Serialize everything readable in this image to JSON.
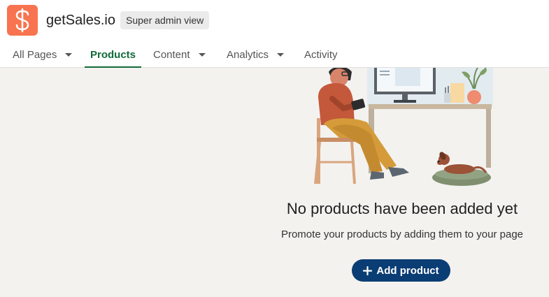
{
  "app": {
    "logo_icon": "dollar-sign-icon",
    "logo_color": "#f8734f",
    "name": "getSales.io",
    "badge": "Super admin view"
  },
  "tabs": [
    {
      "label": "All Pages",
      "dropdown": true,
      "active": false
    },
    {
      "label": "Products",
      "dropdown": false,
      "active": true
    },
    {
      "label": "Content",
      "dropdown": true,
      "active": false
    },
    {
      "label": "Analytics",
      "dropdown": true,
      "active": false
    },
    {
      "label": "Activity",
      "dropdown": false,
      "active": false
    }
  ],
  "empty_state": {
    "illustration": "person-at-desk-with-dog-illustration",
    "title": "No products have been added yet",
    "subtitle": "Promote your products by adding them to your page",
    "button_label": "Add product",
    "button_icon": "plus-icon"
  },
  "colors": {
    "accent_green": "#116b3a",
    "button_navy": "#0a3d74",
    "background": "#f3f2ef"
  }
}
